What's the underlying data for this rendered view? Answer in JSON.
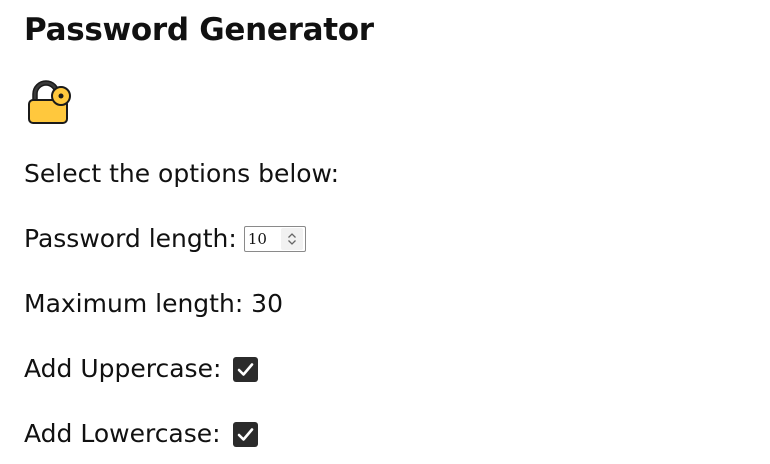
{
  "header": {
    "title": "Password Generator"
  },
  "icons": {
    "lock": "lock-icon"
  },
  "intro": {
    "text": "Select the options below:"
  },
  "password_length": {
    "label": "Password length:",
    "value": "10"
  },
  "maximum_length": {
    "text": "Maximum length: 30"
  },
  "uppercase": {
    "label": "Add Uppercase:",
    "checked": true
  },
  "lowercase": {
    "label": "Add Lowercase:",
    "checked": true
  },
  "colors": {
    "lock_body": "#FFC83D",
    "lock_outline": "#1a1a1a",
    "checkbox_fill": "#2B2B2B"
  }
}
